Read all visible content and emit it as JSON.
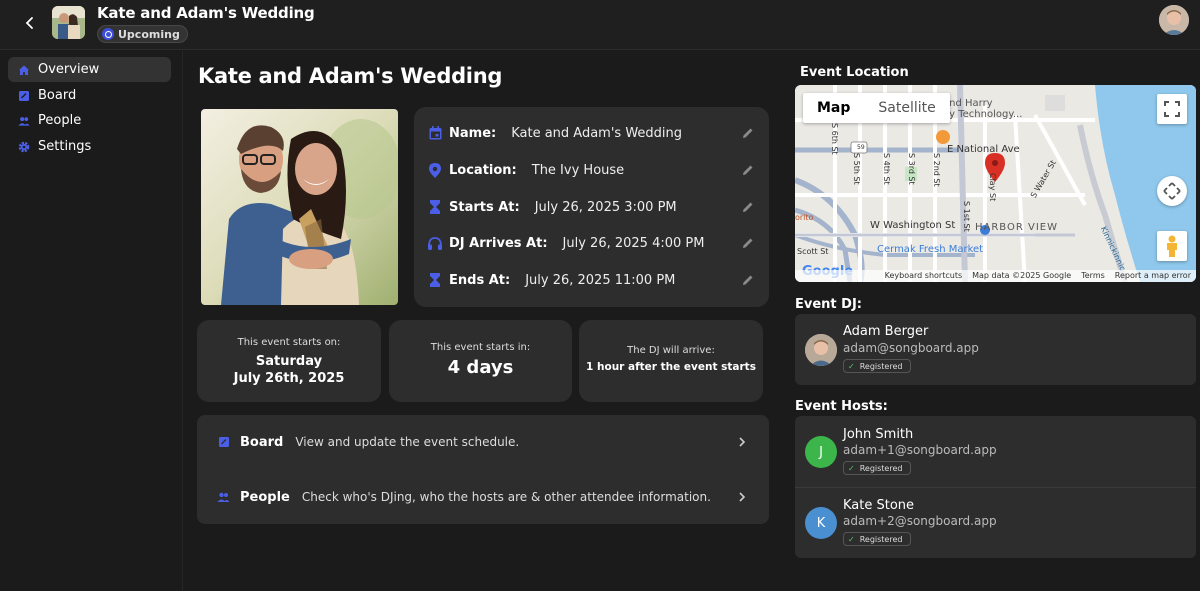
{
  "topbar": {
    "title": "Kate and Adam's Wedding",
    "status": "Upcoming",
    "back_icon": "chevron-left-icon"
  },
  "sidebar": {
    "items": [
      {
        "label": "Overview",
        "icon": "home-icon",
        "active": true
      },
      {
        "label": "Board",
        "icon": "board-icon",
        "active": false
      },
      {
        "label": "People",
        "icon": "people-icon",
        "active": false
      },
      {
        "label": "Settings",
        "icon": "gear-icon",
        "active": false
      }
    ]
  },
  "main": {
    "title": "Kate and Adam's Wedding",
    "details": [
      {
        "label": "Name:",
        "value": "Kate and Adam's Wedding",
        "icon": "calendar-icon"
      },
      {
        "label": "Location:",
        "value": "The Ivy House",
        "icon": "location-pin-icon"
      },
      {
        "label": "Starts At:",
        "value": "July 26, 2025 3:00 PM",
        "icon": "hourglass-icon"
      },
      {
        "label": "DJ Arrives At:",
        "value": "July 26, 2025 4:00 PM",
        "icon": "headphones-icon"
      },
      {
        "label": "Ends At:",
        "value": "July 26, 2025 11:00 PM",
        "icon": "hourglass-icon"
      }
    ],
    "stats": [
      {
        "caption": "This event starts on:",
        "line1": "Saturday",
        "line2": "July 26th, 2025"
      },
      {
        "caption": "This event starts in:",
        "value": "4 days"
      },
      {
        "caption": "The DJ will arrive:",
        "value": "1 hour after the event starts"
      }
    ],
    "links": [
      {
        "title": "Board",
        "desc": "View and update the event schedule.",
        "icon": "board-icon"
      },
      {
        "title": "People",
        "desc": "Check who's DJing, who the hosts are & other attendee information.",
        "icon": "people-icon"
      }
    ]
  },
  "right": {
    "location_heading": "Event Location",
    "map": {
      "tab_map": "Map",
      "tab_satellite": "Satellite",
      "labels": {
        "street_a": "E National Ave",
        "street_b": "W Washington St",
        "street_c": "Cermak Fresh Market",
        "street_d": "HARBOR VIEW",
        "street_e": "S 5th St",
        "street_f": "S 4th St",
        "street_g": "S 3rd St",
        "street_h": "S 2nd St",
        "street_i": "S 1st St",
        "street_j": "S Water St",
        "street_k": "Scott St",
        "street_l": "Kinnickinnic",
        "street_m": "and Harry",
        "street_n": "ey Technology...",
        "street_o": "orito",
        "street_p": "Clay St",
        "street_q": "S 6th St",
        "route_no": "59"
      },
      "logo": "Google",
      "footer": [
        "Keyboard shortcuts",
        "Map data ©2025 Google",
        "Terms",
        "Report a map error"
      ]
    },
    "dj_heading": "Event DJ:",
    "dj": {
      "name": "Adam Berger",
      "email": "adam@songboard.app",
      "badge": "Registered"
    },
    "hosts_heading": "Event Hosts:",
    "hosts": [
      {
        "initial": "J",
        "name": "John Smith",
        "email": "adam+1@songboard.app",
        "badge": "Registered",
        "color": "#3cb54a"
      },
      {
        "initial": "K",
        "name": "Kate Stone",
        "email": "adam+2@songboard.app",
        "badge": "Registered",
        "color": "#4a8fcf"
      }
    ]
  },
  "colors": {
    "accent": "#3d4fd8",
    "card": "#2d2d2d",
    "background": "#1b1b1b",
    "pin": "#d93025"
  }
}
